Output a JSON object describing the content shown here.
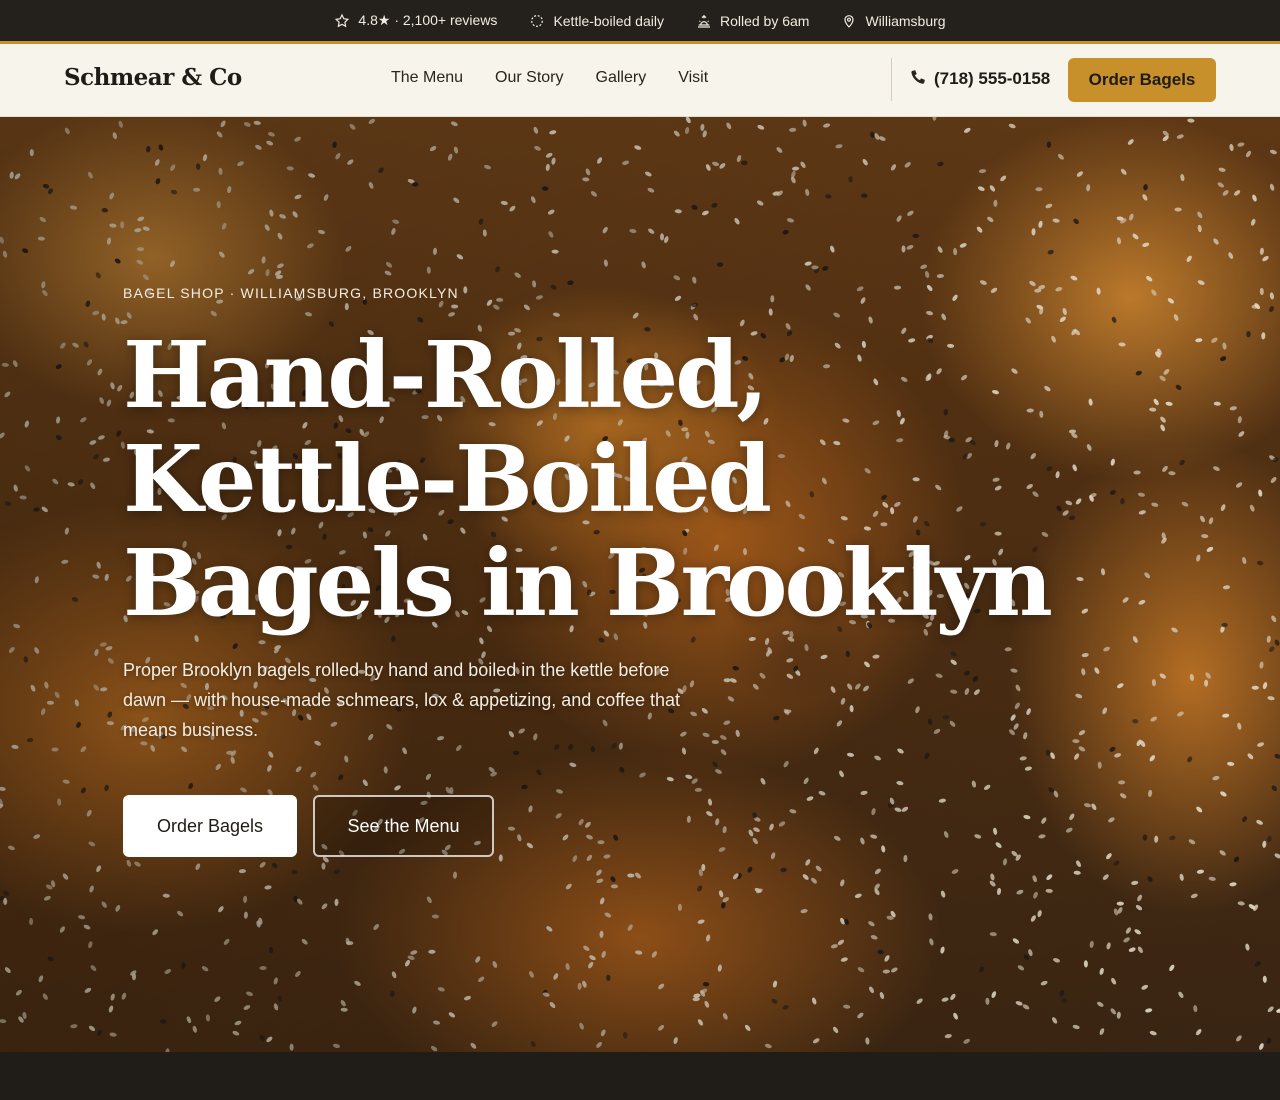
{
  "topbar": {
    "rating": "4.8★ · 2,100+ reviews",
    "rating_icon": "star-outline-icon",
    "boiled": "Kettle-boiled daily",
    "boiled_icon": "dashed-circle-icon",
    "rolled": "Rolled by 6am",
    "rolled_icon": "sunrise-icon",
    "location": "Williamsburg",
    "location_icon": "map-pin-icon"
  },
  "header": {
    "logo": "Schmear & Co",
    "nav": [
      "The Menu",
      "Our Story",
      "Gallery",
      "Visit"
    ],
    "phone": "(718) 555-0158",
    "phone_icon": "phone-icon",
    "order_label": "Order Bagels"
  },
  "hero": {
    "eyebrow": "BAGEL SHOP · WILLIAMSBURG, BROOKLYN",
    "headline": "Hand-Rolled, Kettle-Boiled Bagels in Brooklyn",
    "subtext": "Proper Brooklyn bagels rolled by hand and boiled in the kettle before dawn — with house-made schmears, lox & appetizing, and coffee that means business.",
    "primary_cta": "Order Bagels",
    "secondary_cta": "See the Menu"
  },
  "colors": {
    "accent": "#c8902b",
    "topbar_bg": "#24201b",
    "header_bg": "#f7f4ec",
    "footer_bg": "#201c17"
  }
}
